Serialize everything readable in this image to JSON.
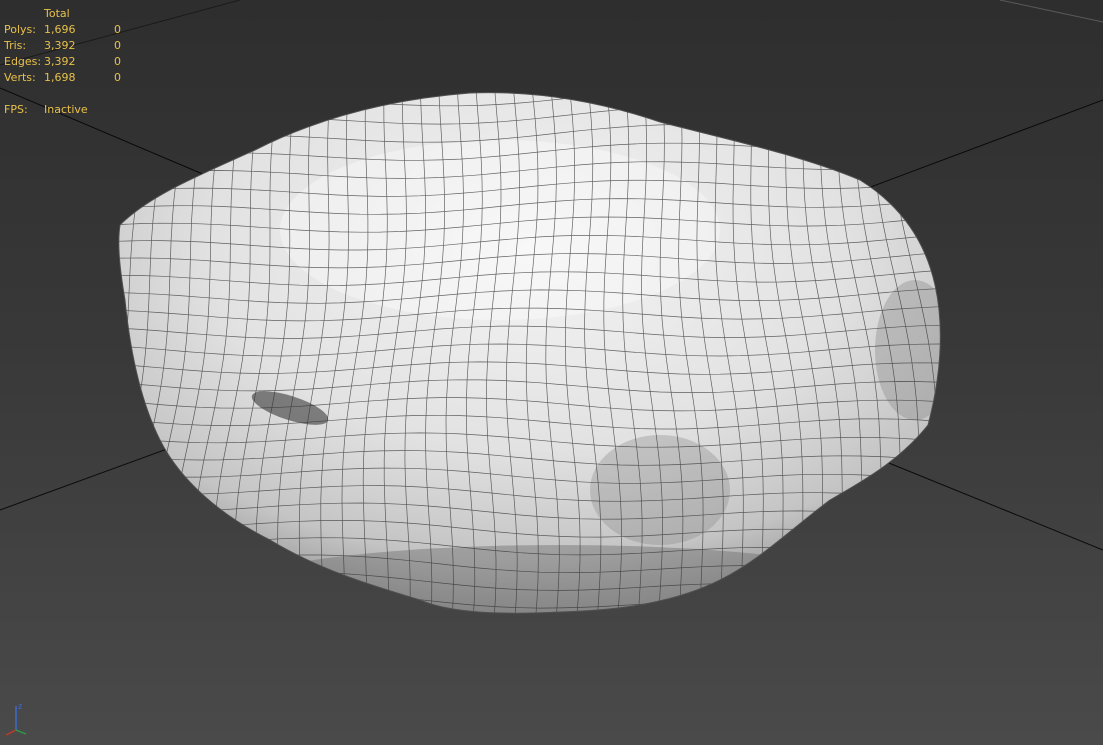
{
  "stats": {
    "header": {
      "label": "",
      "total": "Total",
      "selected": ""
    },
    "rows": [
      {
        "label": "Polys:",
        "total": "1,696",
        "selected": "0"
      },
      {
        "label": "Tris:",
        "total": "3,392",
        "selected": "0"
      },
      {
        "label": "Edges:",
        "total": "3,392",
        "selected": "0"
      },
      {
        "label": "Verts:",
        "total": "1,698",
        "selected": "0"
      }
    ],
    "fps": {
      "label": "FPS:",
      "value": "Inactive"
    }
  },
  "gizmo": {
    "axis_label": "z"
  },
  "colors": {
    "stats_text": "#e8c14a",
    "background_top": "#2e2e2e",
    "background_bottom": "#4a4a4a",
    "mesh_fill": "#e6e6e6",
    "wire": "#333333",
    "grid_line": "#0a0a0a",
    "gizmo_axis": "#3b6dd8"
  },
  "icons": {
    "gizmo": "axis-gizmo-icon"
  }
}
